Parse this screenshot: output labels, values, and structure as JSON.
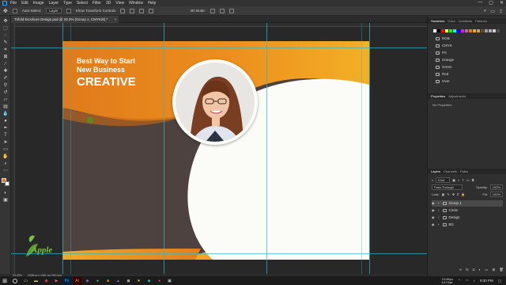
{
  "app": {
    "name": "Ps",
    "window_controls": [
      "—",
      "▢",
      "✕"
    ]
  },
  "menu": [
    "File",
    "Edit",
    "Image",
    "Layer",
    "Type",
    "Select",
    "Filter",
    "3D",
    "View",
    "Window",
    "Help"
  ],
  "options": {
    "auto_select": "Auto-Select:",
    "layer_select": "Layer",
    "show_transform": "Show Transform Controls",
    "mode3d": "3D Mode:"
  },
  "document": {
    "tab_title": "Trifold Brochure Design.psd @ 33.3% (Group 1, CMYK/8) *",
    "tab_close": "×"
  },
  "status": {
    "zoom": "33.33%",
    "size": "1508 px x 1061 px (300 ppi)"
  },
  "brochure": {
    "headline_line1": "Best Way to Start",
    "headline_line2": "New Business",
    "headline_big": "CREATIVE",
    "logo_text": "Apple",
    "colors": {
      "orange": "#e07a1b",
      "amber": "#f1a922",
      "brown": "#4e4240",
      "white": "#fbfbf8"
    }
  },
  "panels": {
    "top_tabs": [
      "Swatches",
      "Color",
      "Gradients",
      "Patterns"
    ],
    "swatch_colors": [
      "#ffffff",
      "#000000",
      "#ff0000",
      "#ffff00",
      "#00ff00",
      "#00ffff",
      "#0000ff",
      "#ff00ff",
      "#888888",
      "#e07a1b",
      "#f1a922",
      "#c8a06a",
      "#6a4a2a",
      "#a0a0a0",
      "#b0b0b0",
      "#d0d0d0",
      "#505050"
    ],
    "folders": [
      "RGB",
      "CMYK",
      "PS",
      "Orange",
      "Green",
      "Red",
      "Over"
    ],
    "properties_tabs": [
      "Properties",
      "Adjustments"
    ],
    "no_properties": "No Properties",
    "layers_tabs": [
      "Layers",
      "Channels",
      "Paths"
    ],
    "kind": "Kind",
    "blend_mode": "Pass Through",
    "opacity_label": "Opacity:",
    "opacity_value": "100%",
    "fill_label": "Fill:",
    "fill_value": "100%",
    "lock_label": "Lock:",
    "layers": [
      {
        "name": "Group 1",
        "selected": true
      },
      {
        "name": "Circle",
        "selected": false
      },
      {
        "name": "Design",
        "selected": false
      },
      {
        "name": "BG",
        "selected": false
      }
    ]
  },
  "taskbar": {
    "time": "9:30 PM",
    "net_speed": "2.5 Mbps",
    "net_speed2": "6.4 Kbps"
  }
}
